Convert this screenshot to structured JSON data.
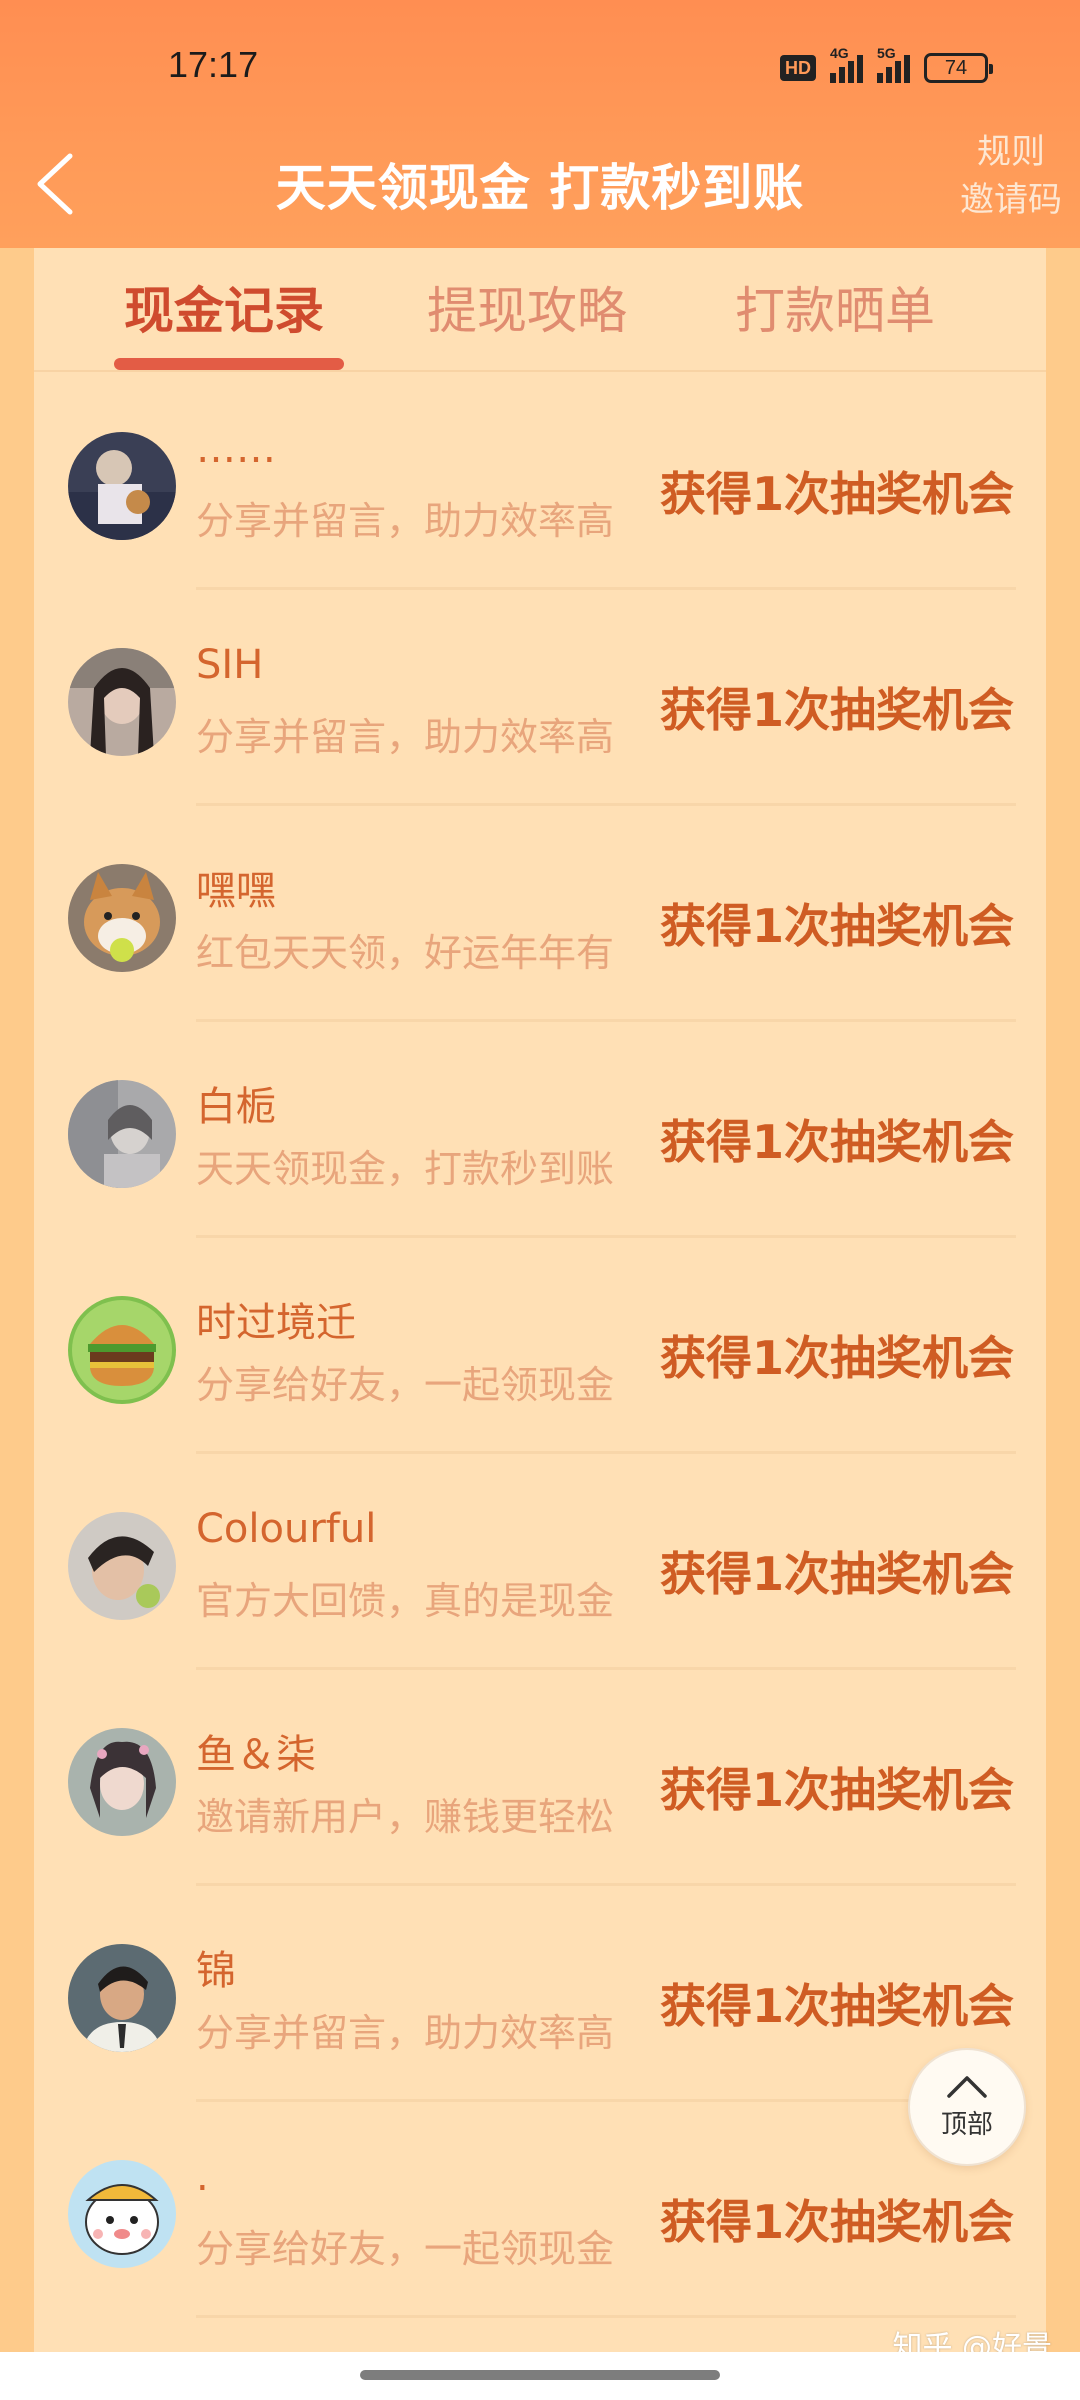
{
  "status_bar": {
    "time": "17:17",
    "hd": "HD",
    "net1": "4G",
    "net2": "5G",
    "battery": "74"
  },
  "header": {
    "title": "天天领现金 打款秒到账",
    "rules": "规则",
    "invite_code": "邀请码"
  },
  "tabs": [
    {
      "label": "现金记录",
      "active": true
    },
    {
      "label": "提现攻略",
      "active": false
    },
    {
      "label": "打款晒单",
      "active": false
    }
  ],
  "records": [
    {
      "name": "……",
      "desc": "分享并留言，助力效率高",
      "reward": "获得1次抽奖机会",
      "avatar": "photo-person-avatar"
    },
    {
      "name": "SIH",
      "desc": "分享并留言，助力效率高",
      "reward": "获得1次抽奖机会",
      "avatar": "photo-woman-avatar"
    },
    {
      "name": "嘿嘿",
      "desc": "红包天天领，好运年年有",
      "reward": "获得1次抽奖机会",
      "avatar": "shiba-dog-avatar"
    },
    {
      "name": "白栀",
      "desc": "天天领现金，打款秒到账",
      "reward": "获得1次抽奖机会",
      "avatar": "gray-photo-avatar"
    },
    {
      "name": "时过境迁",
      "desc": "分享给好友，一起领现金",
      "reward": "获得1次抽奖机会",
      "avatar": "burger-avatar"
    },
    {
      "name": "Colourful",
      "desc": "官方大回馈，真的是现金",
      "reward": "获得1次抽奖机会",
      "avatar": "boy-photo-avatar"
    },
    {
      "name": "鱼＆柒",
      "desc": "邀请新用户，赚钱更轻松",
      "reward": "获得1次抽奖机会",
      "avatar": "girl-photo-avatar"
    },
    {
      "name": "锦",
      "desc": "分享并留言，助力效率高",
      "reward": "获得1次抽奖机会",
      "avatar": "illustrated-man-avatar"
    },
    {
      "name": ".",
      "desc": "分享给好友，一起领现金",
      "reward": "获得1次抽奖机会",
      "avatar": "cartoon-bear-avatar"
    }
  ],
  "to_top_label": "顶部",
  "watermark": "知乎 @好景",
  "colors": {
    "header": "#ff9a58",
    "card_bg": "#ffe0b5",
    "page_bg": "#fecb8b",
    "active_tab": "#cf4b2e",
    "reward": "#cf5c23"
  }
}
